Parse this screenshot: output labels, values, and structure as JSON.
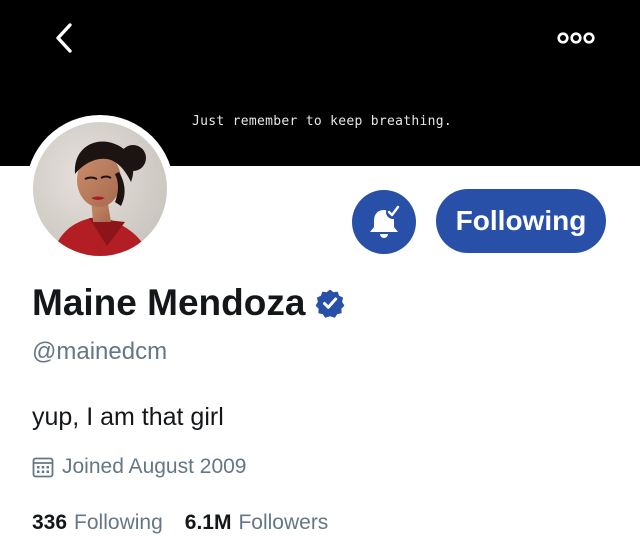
{
  "header": {
    "back_icon": "chevron-left-icon",
    "more_icon": "ellipsis-icon",
    "banner_text": "Just remember to keep breathing."
  },
  "profile": {
    "display_name": "Maine Mendoza",
    "verified": true,
    "handle": "@mainedcm",
    "bio": "yup, I am that girl",
    "joined": "Joined August 2009",
    "avatar": "profile-photo"
  },
  "actions": {
    "notifications_icon": "bell-check-icon",
    "follow_label": "Following"
  },
  "stats": {
    "following_count": "336",
    "following_label": "Following",
    "followers_count": "6.1M",
    "followers_label": "Followers"
  },
  "colors": {
    "accent": "#2850a8",
    "secondary_text": "#657786",
    "primary_text": "#14171a",
    "banner": "#000000"
  }
}
